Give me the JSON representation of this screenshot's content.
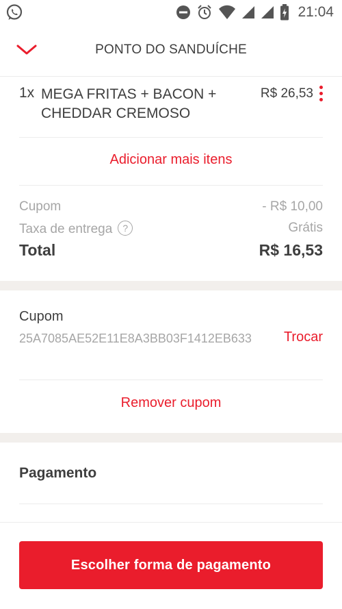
{
  "status_bar": {
    "time": "21:04",
    "icons": [
      "whatsapp-icon",
      "do-not-disturb-icon",
      "alarm-icon",
      "wifi-icon",
      "signal-icon",
      "signal-icon",
      "battery-charging-icon"
    ]
  },
  "header": {
    "title": "PONTO DO SANDUÍCHE",
    "back_icon": "chevron-down-icon"
  },
  "order": {
    "items": [
      {
        "quantity": "1x",
        "name": "MEGA FRITAS + BACON + CHEDDAR CREMOSO",
        "price": "R$ 26,53"
      }
    ],
    "add_more_label": "Adicionar mais itens"
  },
  "summary": {
    "coupon_label": "Cupom",
    "coupon_value": "- R$ 10,00",
    "delivery_fee_label": "Taxa de entrega",
    "delivery_help": "?",
    "delivery_fee_value": "Grátis",
    "total_label": "Total",
    "total_value": "R$ 16,53"
  },
  "coupon_section": {
    "title": "Cupom",
    "code": "25A7085AE52E11E8A3BB03F1412EB633",
    "change_label": "Trocar",
    "remove_label": "Remover cupom"
  },
  "payment": {
    "title": "Pagamento",
    "cta_label": "Escolher forma de pagamento"
  },
  "colors": {
    "accent": "#ea1d2c",
    "text": "#3e3e3e",
    "muted": "#a6a6a6",
    "band": "#f2efec"
  }
}
